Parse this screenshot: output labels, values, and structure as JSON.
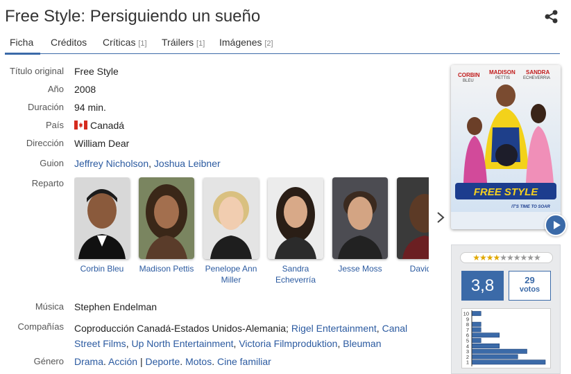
{
  "title": "Free Style: Persiguiendo un sueño",
  "tabs": [
    {
      "label": "Ficha",
      "count": ""
    },
    {
      "label": "Créditos",
      "count": ""
    },
    {
      "label": "Críticas",
      "count": "[1]"
    },
    {
      "label": "Tráilers",
      "count": "[1]"
    },
    {
      "label": "Imágenes",
      "count": "[2]"
    }
  ],
  "info": {
    "original_title_label": "Título original",
    "original_title": "Free Style",
    "year_label": "Año",
    "year": "2008",
    "duration_label": "Duración",
    "duration": "94 min.",
    "country_label": "País",
    "country": "Canadá",
    "director_label": "Dirección",
    "director": "William Dear",
    "screenplay_label": "Guion",
    "screenplay": [
      "Jeffrey Nicholson",
      "Joshua Leibner"
    ],
    "cast_label": "Reparto",
    "music_label": "Música",
    "music": "Stephen Endelman",
    "companies_label": "Compañías",
    "companies_prefix": "Coproducción Canadá-Estados Unidos-Alemania;",
    "companies": [
      "Rigel Entertainment",
      "Canal Street Films",
      "Up North Entertainment",
      "Victoria Filmproduktion",
      "Bleuman"
    ],
    "genre_label": "Género",
    "genre": [
      "Drama",
      "Acción",
      "Deporte",
      "Motos",
      "Cine familiar"
    ]
  },
  "cast": [
    {
      "name": "Corbin Bleu"
    },
    {
      "name": "Madison Pettis"
    },
    {
      "name": "Penelope Ann Miller"
    },
    {
      "name": "Sandra Echeverría"
    },
    {
      "name": "Jesse Moss"
    },
    {
      "name": "David R"
    }
  ],
  "poster": {
    "actors_top": [
      "CORBIN",
      "MADISON",
      "SANDRA"
    ],
    "actors_bottom": [
      "BLEU",
      "PETTIS",
      "ECHEVERRIA"
    ],
    "logo": "FREE STYLE",
    "tagline": "IT'S TIME TO SOAR"
  },
  "rating": {
    "stars_filled": 4,
    "stars_total": 10,
    "average": "3,8",
    "votes": "29",
    "votes_label": "votos",
    "histogram": [
      {
        "score": "10",
        "count": 1
      },
      {
        "score": "9",
        "count": 0
      },
      {
        "score": "8",
        "count": 1
      },
      {
        "score": "7",
        "count": 1
      },
      {
        "score": "6",
        "count": 3
      },
      {
        "score": "5",
        "count": 1
      },
      {
        "score": "4",
        "count": 3
      },
      {
        "score": "3",
        "count": 6
      },
      {
        "score": "2",
        "count": 5
      },
      {
        "score": "1",
        "count": 8
      }
    ]
  },
  "colors": {
    "accent": "#3b6aa8",
    "link": "#2b5aa0"
  }
}
